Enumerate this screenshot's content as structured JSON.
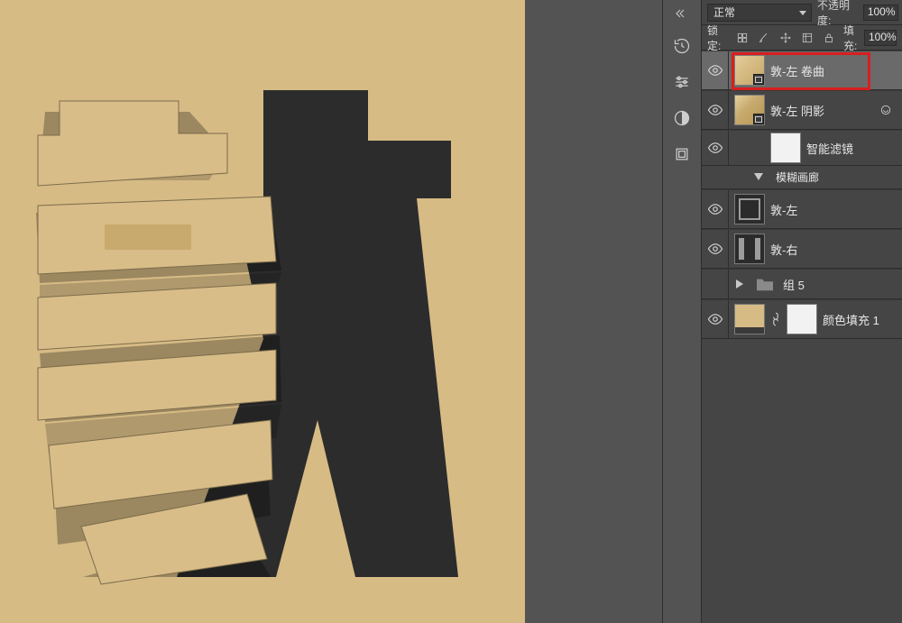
{
  "panel": {
    "blend_mode": "正常",
    "opacity_label": "不透明度:",
    "opacity_value": "100%",
    "lock_label": "锁定:",
    "fill_label": "填充:",
    "fill_value": "100%"
  },
  "layers": [
    {
      "name": "敦-左 卷曲",
      "visible": true,
      "selected": true,
      "highlight": true,
      "thumb": "beige-smart"
    },
    {
      "name": "敦-左 阴影",
      "visible": true,
      "thumb": "beige2-smart",
      "expanded": true,
      "children": [
        {
          "kind": "filter-mask",
          "visible": true,
          "mask": true,
          "name": "智能滤镜"
        },
        {
          "kind": "filter-item",
          "name": "模糊画廊"
        }
      ]
    },
    {
      "name": "敦-左",
      "visible": true,
      "thumb": "dark"
    },
    {
      "name": "敦-右",
      "visible": true,
      "thumb": "dark2"
    },
    {
      "name": "组 5",
      "visible": false,
      "thumb": "folder",
      "collapsed": true
    },
    {
      "name": "颜色填充 1",
      "visible": true,
      "thumb": "monitor-linked"
    }
  ],
  "icons": {
    "history": "history-icon",
    "sliders": "adjustments-icon",
    "contrast": "contrast-icon",
    "artboard": "artboard-icon",
    "pixels": "lock-pixels-icon",
    "brush": "lock-brush-icon",
    "move": "lock-move-icon",
    "frame": "lock-frame-icon",
    "lock": "lock-all-icon"
  }
}
